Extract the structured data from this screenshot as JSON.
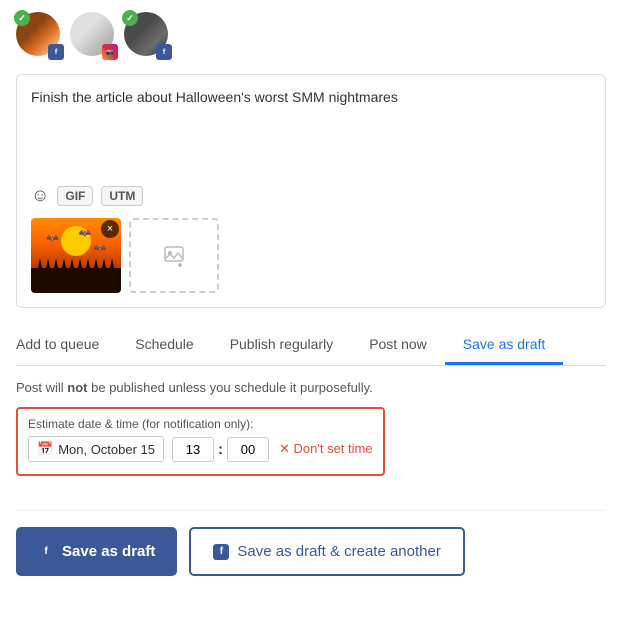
{
  "avatars": [
    {
      "id": "av1",
      "type": "facebook",
      "badge": "f",
      "badge_class": "badge-fb",
      "has_check": true
    },
    {
      "id": "av2",
      "type": "instagram",
      "badge": "inst",
      "badge_class": "badge-ig",
      "has_check": false
    },
    {
      "id": "av3",
      "type": "facebook2",
      "badge": "f",
      "badge_class": "badge-fb",
      "has_check": true
    }
  ],
  "compose": {
    "text": "Finish the article about Halloween's worst SMM nightmares",
    "toolbar": {
      "emoji_label": "☺",
      "gif_label": "GIF",
      "utm_label": "UTM"
    }
  },
  "tabs": [
    {
      "id": "add-to-queue",
      "label": "Add to queue",
      "active": false
    },
    {
      "id": "schedule",
      "label": "Schedule",
      "active": false
    },
    {
      "id": "publish-regularly",
      "label": "Publish regularly",
      "active": false
    },
    {
      "id": "post-now",
      "label": "Post now",
      "active": false
    },
    {
      "id": "save-as-draft",
      "label": "Save as draft",
      "active": true
    }
  ],
  "draft": {
    "note": "Post will ",
    "note_bold": "not",
    "note_end": " be published unless you schedule it purposefully.",
    "estimate_label": "Estimate date & time (for notification only):",
    "date_value": "Mon, October 15",
    "time_hour": "13",
    "time_min": "00",
    "dont_set_label": "✕ Don't set time"
  },
  "buttons": {
    "primary_fb_icon": "f",
    "primary_label": "Save as draft",
    "secondary_fb_icon": "f",
    "secondary_label": "Save as draft & create another"
  }
}
